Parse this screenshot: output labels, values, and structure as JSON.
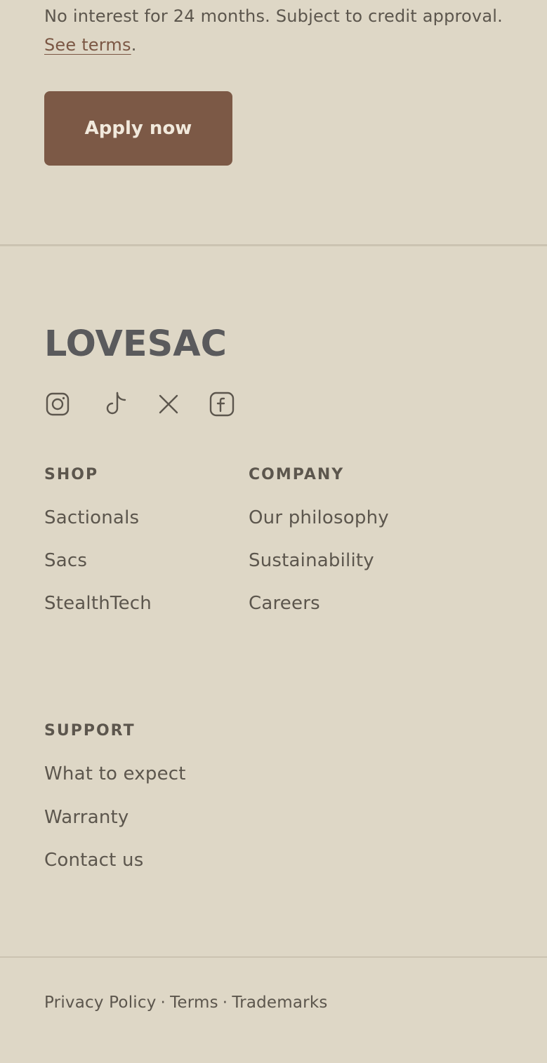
{
  "promo": {
    "text": "No interest for 24 months. Subject to credit approval.",
    "link_text": "See terms",
    "trailing": ".",
    "button_label": "Apply now"
  },
  "brand": {
    "name": "LOVESAC"
  },
  "socials": [
    {
      "icon": "instagram-icon"
    },
    {
      "icon": "tiktok-icon"
    },
    {
      "icon": "x-icon"
    },
    {
      "icon": "facebook-icon"
    }
  ],
  "footer": {
    "shop": {
      "title": "SHOP",
      "links": [
        "Sactionals",
        "Sacs",
        "StealthTech"
      ]
    },
    "company": {
      "title": "COMPANY",
      "links": [
        "Our philosophy",
        "Sustainability",
        "Careers"
      ]
    },
    "support": {
      "title": "SUPPORT",
      "links": [
        "What to expect",
        "Warranty",
        "Contact us"
      ]
    }
  },
  "legal": {
    "links": [
      "Privacy Policy",
      "Terms",
      "Trademarks"
    ],
    "separator": "·"
  },
  "colors": {
    "background": "#ded7c6",
    "button": "#7c5946",
    "text": "#5c564d",
    "link_accent": "#7b5744",
    "logo": "#5a5a5c"
  }
}
